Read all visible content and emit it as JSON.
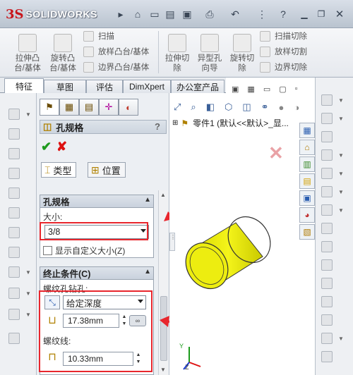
{
  "app": {
    "logo_ds": "3S",
    "logo_name": "SOLIDWORKS"
  },
  "ribbon": {
    "extrude_boss": "拉伸凸\n台/基体",
    "revolve_boss": "旋转凸\n台/基体",
    "sweep": "扫描",
    "loft_boss": "放样凸台/基体",
    "boundary_boss": "边界凸台/基体",
    "extrude_cut": "拉伸切\n除",
    "hole_wizard": "异型孔\n向导",
    "revolve_cut": "旋转切\n除",
    "sweep_cut": "扫描切除",
    "loft_cut": "放样切割",
    "boundary_cut": "边界切除"
  },
  "tabs": [
    "特征",
    "草图",
    "评估",
    "DimXpert",
    "办公室产品"
  ],
  "property_manager": {
    "title": "孔规格",
    "help": "?",
    "subtab_type": "类型",
    "subtab_position": "位置",
    "hole_spec": {
      "header": "孔规格",
      "size_label": "大小:",
      "size_value": "3/8",
      "custom_size_label": "显示自定义大小(Z)"
    },
    "end_condition": {
      "header": "终止条件(C)",
      "thread_drill_label": "螺纹孔钻孔:",
      "end_type": "给定深度",
      "drill_depth": "17.38mm",
      "thread_label": "螺纹线:",
      "thread_depth": "10.33mm"
    }
  },
  "graphics": {
    "tree_root": "零件1  (默认<<默认>_显..."
  },
  "colors": {
    "annotation_red": "#e8262d",
    "part_yellow": "#e6e600"
  }
}
